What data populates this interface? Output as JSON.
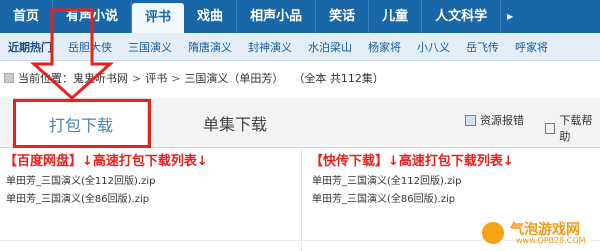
{
  "main_nav": {
    "tabs": [
      {
        "label": "首页",
        "active": false
      },
      {
        "label": "有声小说",
        "active": false
      },
      {
        "label": "评书",
        "active": true
      },
      {
        "label": "戏曲",
        "active": false
      },
      {
        "label": "相声小品",
        "active": false
      },
      {
        "label": "笑话",
        "active": false
      },
      {
        "label": "儿童",
        "active": false
      },
      {
        "label": "人文科学",
        "active": false
      }
    ],
    "more_symbol": "▸"
  },
  "sub_nav": {
    "items": [
      "近期热门",
      "岳胆大侠",
      "三国演义",
      "隋唐演义",
      "封神演义",
      "水泊梁山",
      "杨家将",
      "小八义",
      "岳飞传",
      "呼家将"
    ]
  },
  "breadcrumb": {
    "prefix": "当前位置：",
    "site": "鬼鬼听书网",
    "sep1": ">",
    "category": "评书",
    "sep2": ">",
    "current": "三国演义（单田芳）",
    "meta": "（全本 共112集）"
  },
  "download": {
    "tabs": [
      {
        "label": "打包下载",
        "active": true
      },
      {
        "label": "单集下载",
        "active": false
      }
    ],
    "tools": {
      "report": "资源报错",
      "help": "下载帮助"
    },
    "columns": [
      {
        "title": "【百度网盘】↓高速打包下载列表↓",
        "files": [
          "单田芳_三国演义(全112回版).zip",
          "单田芳_三国演义(全86回版).zip"
        ]
      },
      {
        "title": "【快传下载】↓高速打包下载列表↓",
        "files": [
          "单田芳_三国演义(全112回版).zip",
          "单田芳_三国演义(全86回版).zip"
        ]
      }
    ]
  },
  "watermark": {
    "name": "气泡游戏网",
    "url": "www.QPB28.COM"
  },
  "colors": {
    "nav_blue": "#1a67a8",
    "annotation_red": "#e8211c",
    "active_tab_text": "#4a86b8",
    "watermark_orange": "#f39a12"
  }
}
